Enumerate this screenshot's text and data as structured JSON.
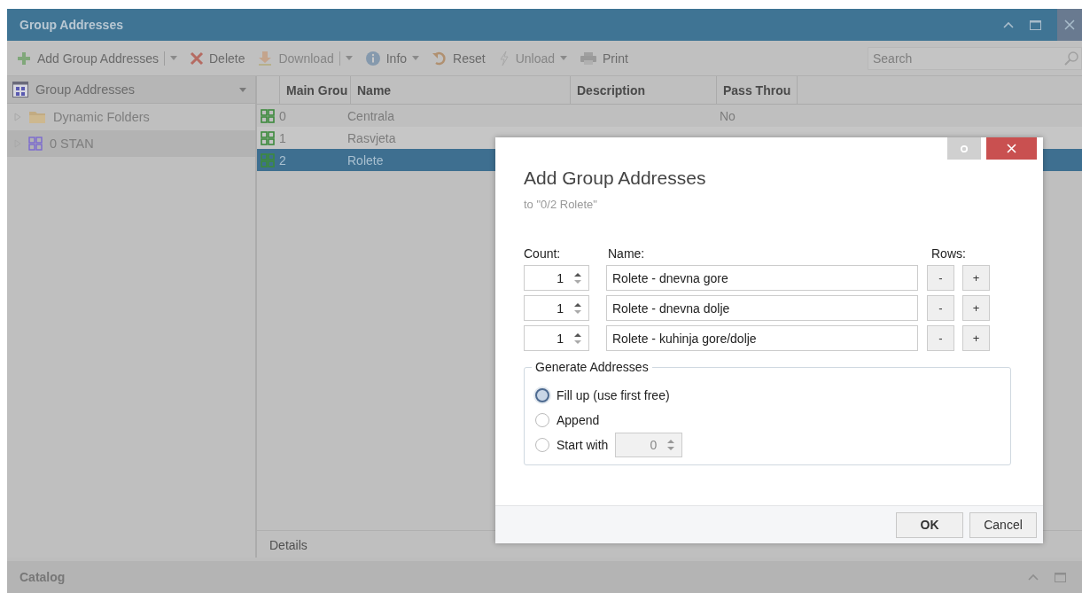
{
  "window": {
    "title": "Group Addresses"
  },
  "toolbar": [
    {
      "label": "Add Group Addresses",
      "split": true,
      "dropdown": true,
      "disabled": false
    },
    {
      "label": "Delete",
      "split": false,
      "dropdown": false,
      "disabled": false
    },
    {
      "label": "Download",
      "split": true,
      "dropdown": true,
      "disabled": true
    },
    {
      "label": "Info",
      "split": false,
      "dropdown": true,
      "disabled": false
    },
    {
      "label": "Reset",
      "split": false,
      "dropdown": false,
      "disabled": false
    },
    {
      "label": "Unload",
      "split": false,
      "dropdown": true,
      "disabled": true
    },
    {
      "label": "Print",
      "split": false,
      "dropdown": false,
      "disabled": false
    }
  ],
  "search": {
    "placeholder": "Search"
  },
  "tree": {
    "header": "Group Addresses",
    "items": [
      {
        "label": "Dynamic Folders",
        "kind": "folder",
        "selected": false,
        "expanded": false
      },
      {
        "label": "0 STAN",
        "kind": "group",
        "selected": true,
        "expanded": false
      }
    ]
  },
  "table": {
    "columns": [
      "Main Grou",
      "Name",
      "Description",
      "Pass Throu"
    ],
    "rows": [
      {
        "main_group": "0",
        "name": "Centrala",
        "pass_through": "No",
        "selected": false
      },
      {
        "main_group": "1",
        "name": "Rasvjeta",
        "selected": false
      },
      {
        "main_group": "2",
        "name": "Rolete",
        "selected": true
      }
    ]
  },
  "details_tab": {
    "label": "Details"
  },
  "catalog": {
    "title": "Catalog"
  },
  "dialog": {
    "title": "Add Group Addresses",
    "subtitle": "to \"0/2 Rolete\"",
    "headers": {
      "count": "Count:",
      "name": "Name:",
      "rows": "Rows:"
    },
    "rows": [
      {
        "count": "1",
        "name": "Rolete - dnevna gore",
        "remove": "-",
        "add": "+"
      },
      {
        "count": "1",
        "name": "Rolete - dnevna dolje",
        "remove": "-",
        "add": "+"
      },
      {
        "count": "1",
        "name": "Rolete - kuhinja gore/dolje",
        "remove": "-",
        "add": "+"
      }
    ],
    "generate": {
      "title": "Generate Addresses",
      "options": [
        {
          "label": "Fill up (use first free)",
          "selected": true
        },
        {
          "label": "Append",
          "selected": false
        },
        {
          "label": "Start with",
          "selected": false,
          "value": "0",
          "disabled": true
        }
      ]
    },
    "buttons": [
      "OK",
      "Cancel"
    ]
  }
}
